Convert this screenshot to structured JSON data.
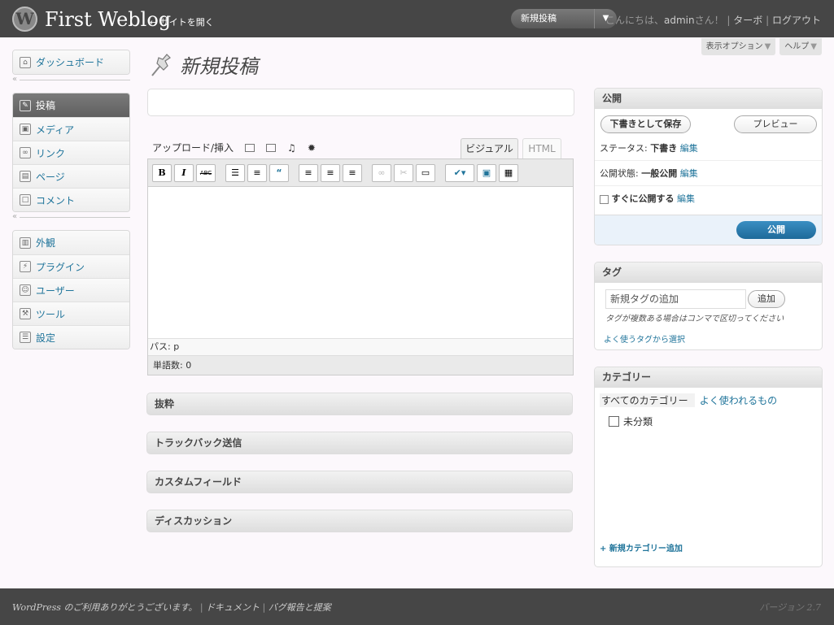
{
  "header": {
    "site_title": "First Weblog",
    "visit_site": "← サイトを開く",
    "favorite_action": "新規投稿",
    "greeting_prefix": "こんにちは、",
    "username": "admin",
    "greeting_suffix": "さん！ |",
    "turbo": "ターボ",
    "logout": "ログアウト"
  },
  "screen_options": {
    "options_label": "表示オプション",
    "help_label": "ヘルプ"
  },
  "menu": {
    "dashboard": "ダッシュボード",
    "posts": "投稿",
    "media": "メディア",
    "links": "リンク",
    "pages": "ページ",
    "comments": "コメント",
    "appearance": "外観",
    "plugins": "プラグイン",
    "users": "ユーザー",
    "tools": "ツール",
    "settings": "設定"
  },
  "page": {
    "title": "新規投稿"
  },
  "editor": {
    "upload_insert": "アップロード/挿入",
    "tab_visual": "ビジュアル",
    "tab_html": "HTML",
    "path": "パス: p",
    "word_count": "単語数: 0",
    "toolbar": {
      "bold": "B",
      "italic": "I",
      "strike": "ABC"
    }
  },
  "postboxes": {
    "excerpt": "抜粋",
    "trackbacks": "トラックバック送信",
    "custom_fields": "カスタムフィールド",
    "discussion": "ディスカッション"
  },
  "publish": {
    "title": "公開",
    "save_draft": "下書きとして保存",
    "preview": "プレビュー",
    "status_label": "ステータス:",
    "status_value": "下書き",
    "visibility_label": "公開状態:",
    "visibility_value": "一般公開",
    "schedule": "すぐに公開する",
    "edit": "編集",
    "publish_button": "公開"
  },
  "tags": {
    "title": "タグ",
    "input_value": "新規タグの追加",
    "add": "追加",
    "hint": "タグが複数ある場合はコンマで区切ってください",
    "popular": "よく使うタグから選択"
  },
  "categories": {
    "title": "カテゴリー",
    "tab_all": "すべてのカテゴリー",
    "tab_popular": "よく使われるもの",
    "item": "未分類",
    "add_new": "+ 新規カテゴリー追加"
  },
  "footer": {
    "thanks": "WordPress のご利用ありがとうございます。",
    "docs": "ドキュメント",
    "feedback": "バグ報告と提案",
    "version": "バージョン 2.7"
  }
}
